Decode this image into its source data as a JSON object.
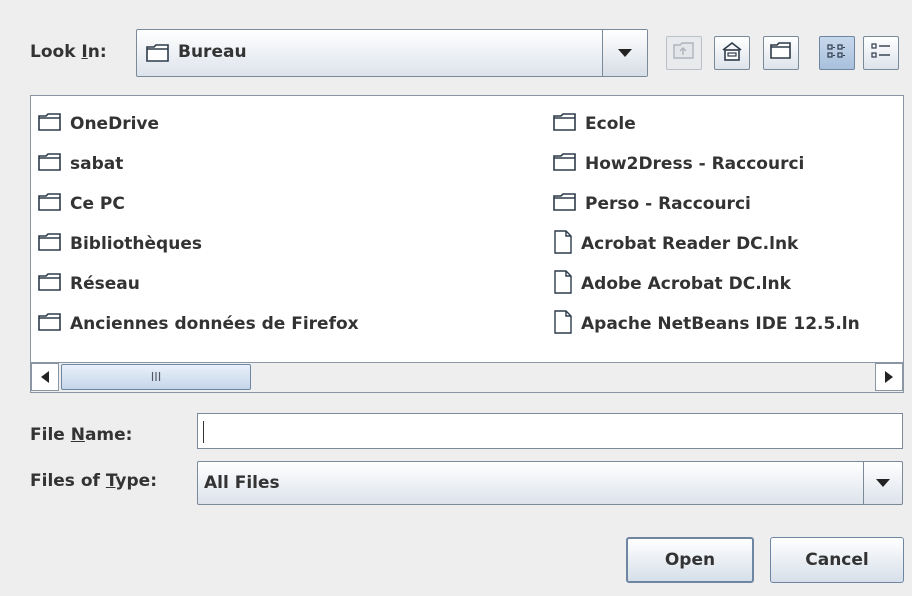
{
  "dialog": {
    "look_in": {
      "label_pre": "Look ",
      "label_mnemonic": "I",
      "label_post": "n:",
      "selected": "Bureau",
      "folder_icon": "folder-icon",
      "arrow_icon": "chevron-down-icon"
    },
    "toolbar": [
      {
        "name": "up-one-level",
        "icon": "up-folder-icon",
        "enabled": false
      },
      {
        "name": "home",
        "icon": "home-icon",
        "enabled": true
      },
      {
        "name": "create-new-folder",
        "icon": "new-folder-icon",
        "enabled": true
      },
      {
        "name": "list-view",
        "icon": "list-view-icon",
        "selected": true
      },
      {
        "name": "details-view",
        "icon": "details-view-icon",
        "selected": false
      }
    ],
    "files": [
      {
        "name": "OneDrive",
        "type": "folder"
      },
      {
        "name": "sabat",
        "type": "folder"
      },
      {
        "name": "Ce PC",
        "type": "folder"
      },
      {
        "name": "Bibliothèques",
        "type": "folder"
      },
      {
        "name": "Réseau",
        "type": "folder"
      },
      {
        "name": "Anciennes données de Firefox",
        "type": "folder"
      },
      {
        "name": "Ecole",
        "type": "folder"
      },
      {
        "name": "How2Dress - Raccourci",
        "type": "folder"
      },
      {
        "name": "Perso - Raccourci",
        "type": "folder"
      },
      {
        "name": "Acrobat Reader DC.lnk",
        "type": "file"
      },
      {
        "name": "Adobe Acrobat DC.lnk",
        "type": "file"
      },
      {
        "name": "Apache NetBeans IDE 12.5.ln",
        "type": "file"
      }
    ],
    "scrollbar": {
      "left_icon": "arrow-left-icon",
      "right_icon": "arrow-right-icon",
      "grip": "III"
    },
    "file_name": {
      "label_pre": "File ",
      "label_mnemonic": "N",
      "label_post": "ame:",
      "value": ""
    },
    "file_type": {
      "label_pre": "Files of ",
      "label_mnemonic": "T",
      "label_post": "ype:",
      "selected": "All Files",
      "arrow_icon": "chevron-down-icon"
    },
    "buttons": {
      "open": "Open",
      "cancel": "Cancel"
    }
  }
}
